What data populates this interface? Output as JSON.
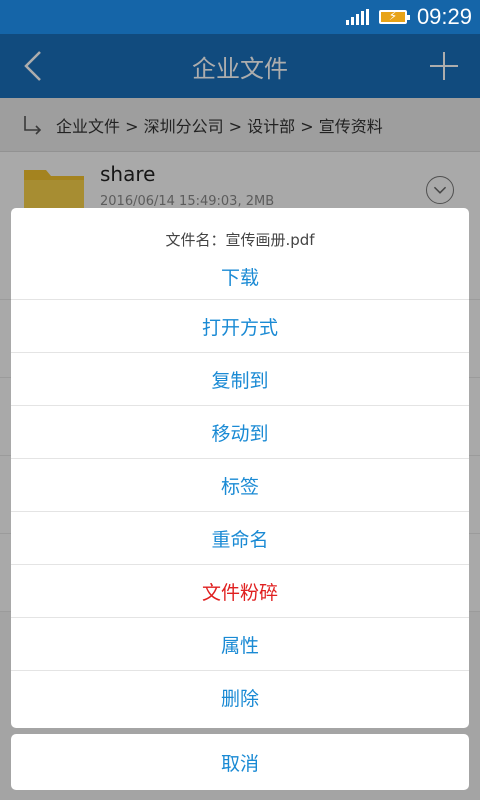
{
  "status_bar": {
    "time": "09:29"
  },
  "app_bar": {
    "title": "企业文件"
  },
  "breadcrumb": {
    "path": "企业文件 > 深圳分公司 > 设计部 > 宣传资料"
  },
  "file": {
    "name": "share",
    "meta": "2016/06/14  15:49:03, 2MB"
  },
  "sheet": {
    "title": "文件名：宣传画册.pdf",
    "items": [
      "下载",
      "打开方式",
      "复制到",
      "移动到",
      "标签",
      "重命名",
      "文件粉碎",
      "属性",
      "删除"
    ],
    "cancel_label": "取消"
  },
  "colors": {
    "primary": "#1a6fba",
    "status_bar": "#1565a8",
    "action_text": "#1a8ad4",
    "danger_text": "#e02020"
  }
}
